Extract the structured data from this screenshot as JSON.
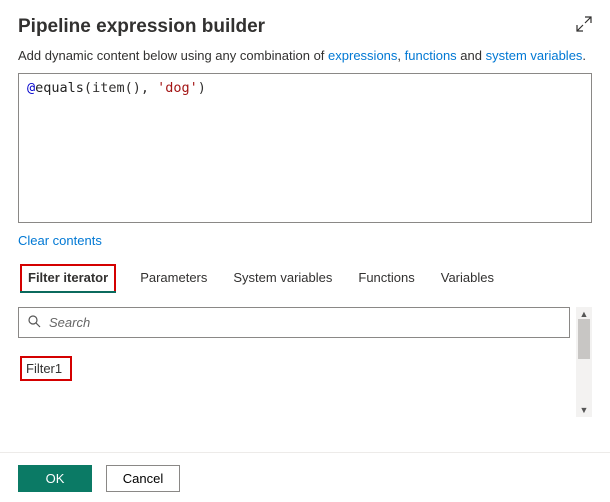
{
  "header": {
    "title": "Pipeline expression builder"
  },
  "subtitle": {
    "prefix": "Add dynamic content below using any combination of ",
    "link1": "expressions",
    "sep1": ", ",
    "link2": "functions",
    "sep2": " and ",
    "link3": "system variables",
    "suffix": "."
  },
  "editor": {
    "at": "@",
    "fn": "equals",
    "paren_open": "(",
    "item_call": "item()",
    "comma": ", ",
    "str": "'dog'",
    "paren_close": ")"
  },
  "clear_contents": "Clear contents",
  "tabs": {
    "filter_iterator": "Filter iterator",
    "parameters": "Parameters",
    "system_variables": "System variables",
    "functions": "Functions",
    "variables": "Variables"
  },
  "search": {
    "placeholder": "Search"
  },
  "results": {
    "item1": "Filter1"
  },
  "footer": {
    "ok": "OK",
    "cancel": "Cancel"
  }
}
